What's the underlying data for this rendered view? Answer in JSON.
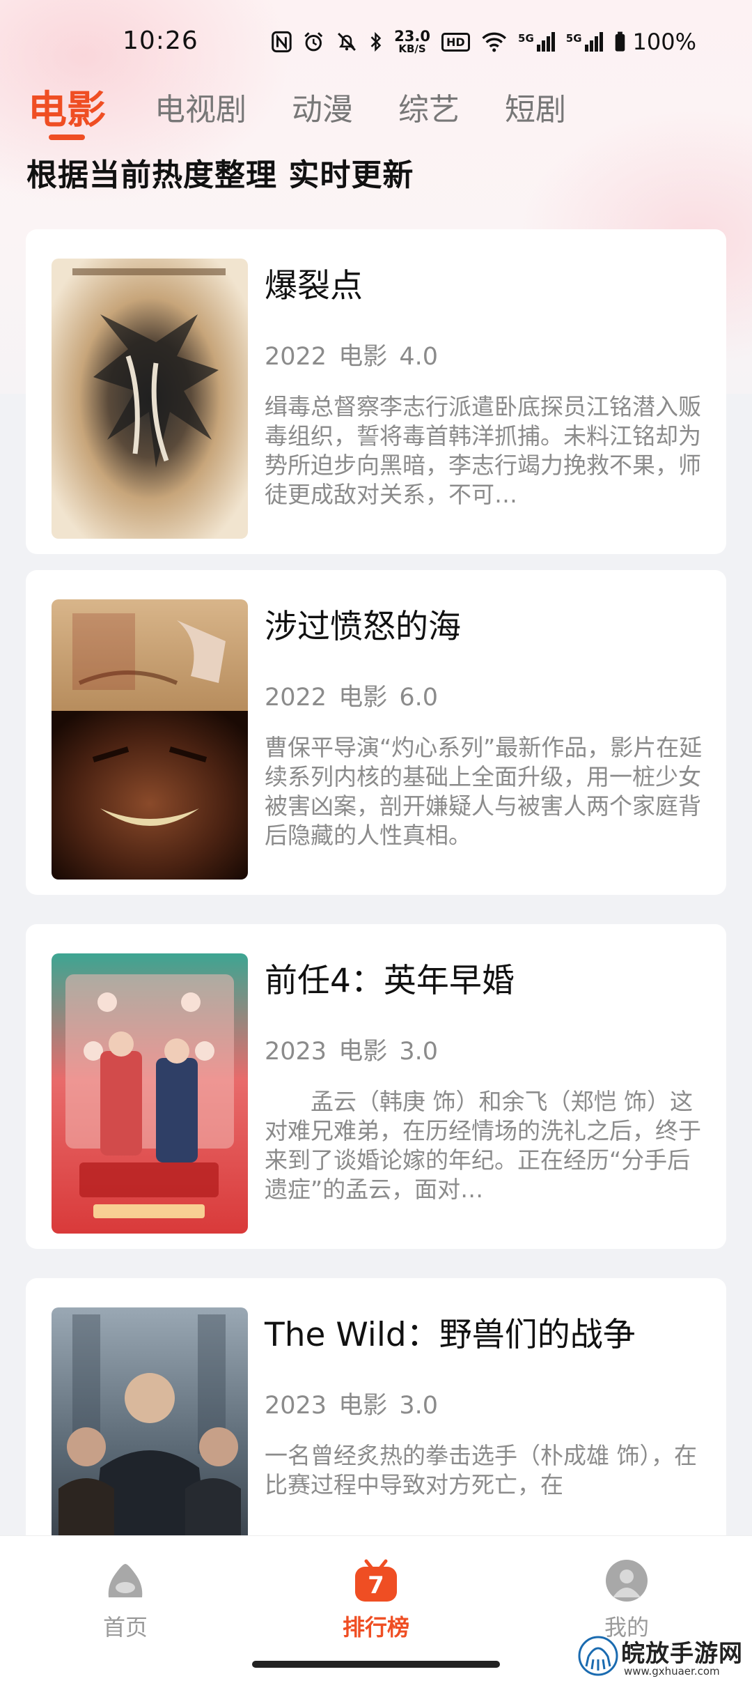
{
  "status_bar": {
    "time": "10:26",
    "net_speed_value": "23.0",
    "net_speed_unit": "KB/S",
    "hd_badge": "HD",
    "sim1_type": "5G",
    "sim2_type": "5G",
    "battery": "100%"
  },
  "tabs": [
    {
      "label": "电影",
      "active": true
    },
    {
      "label": "电视剧",
      "active": false
    },
    {
      "label": "动漫",
      "active": false
    },
    {
      "label": "综艺",
      "active": false
    },
    {
      "label": "短剧",
      "active": false
    }
  ],
  "subtitle": "根据当前热度整理 实时更新",
  "movies": [
    {
      "title": "爆裂点",
      "year": "2022",
      "category": "电影",
      "score": "4.0",
      "description": "缉毒总督察李志行派遣卧底探员江铭潜入贩毒组织，誓将毒首韩洋抓捕。未料江铭却为势所迫步向黑暗，李志行竭力挽救不果，师徒更成敌对关系，不可…"
    },
    {
      "title": "涉过愤怒的海",
      "year": "2022",
      "category": "电影",
      "score": "6.0",
      "description": "曹保平导演“灼心系列”最新作品，影片在延续系列内核的基础上全面升级，用一桩少女被害凶案，剖开嫌疑人与被害人两个家庭背后隐藏的人性真相。"
    },
    {
      "title": "前任4：英年早婚",
      "year": "2023",
      "category": "电影",
      "score": "3.0",
      "description": "　　孟云（韩庚 饰）和余飞（郑恺 饰）这对难兄难弟，在历经情场的洗礼之后，终于来到了谈婚论嫁的年纪。正在经历“分手后遗症”的孟云，面对…"
    },
    {
      "title": "The Wild：野兽们的战争",
      "year": "2023",
      "category": "电影",
      "score": "3.0",
      "description": "一名曾经炙热的拳击选手（朴成雄 饰），在比赛过程中导致对方死亡，在"
    }
  ],
  "bottom_nav": [
    {
      "label": "首页",
      "active": false
    },
    {
      "label": "排行榜",
      "active": true,
      "badge_digit": "7"
    },
    {
      "label": "我的",
      "active": false
    }
  ],
  "watermark": {
    "text": "皖放手游网",
    "url": "www.gxhuaer.com"
  },
  "colors": {
    "accent": "#ef4e23",
    "text_primary": "#111111",
    "text_secondary": "#8b8b8b",
    "background": "#f1f2f5"
  }
}
